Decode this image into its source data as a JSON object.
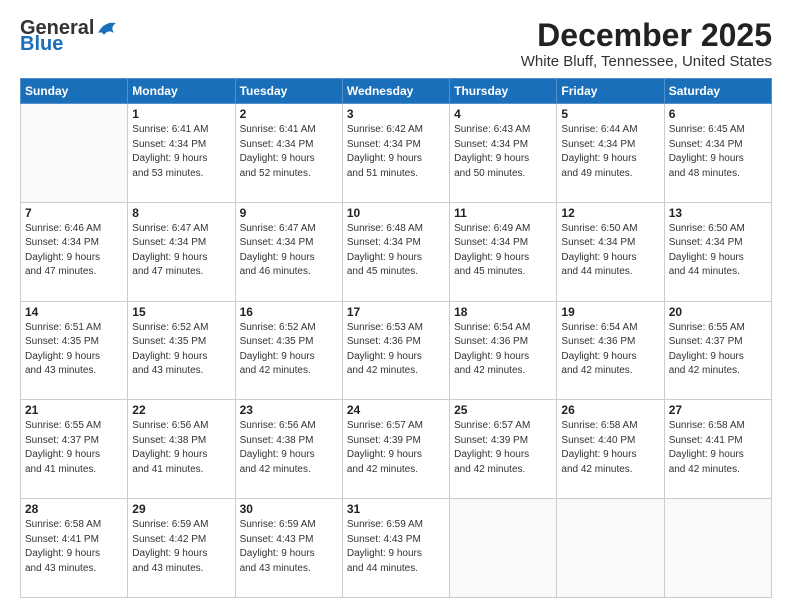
{
  "header": {
    "logo_general": "General",
    "logo_blue": "Blue",
    "month": "December 2025",
    "location": "White Bluff, Tennessee, United States"
  },
  "days_of_week": [
    "Sunday",
    "Monday",
    "Tuesday",
    "Wednesday",
    "Thursday",
    "Friday",
    "Saturday"
  ],
  "weeks": [
    [
      {
        "day": "",
        "info": ""
      },
      {
        "day": "1",
        "info": "Sunrise: 6:41 AM\nSunset: 4:34 PM\nDaylight: 9 hours\nand 53 minutes."
      },
      {
        "day": "2",
        "info": "Sunrise: 6:41 AM\nSunset: 4:34 PM\nDaylight: 9 hours\nand 52 minutes."
      },
      {
        "day": "3",
        "info": "Sunrise: 6:42 AM\nSunset: 4:34 PM\nDaylight: 9 hours\nand 51 minutes."
      },
      {
        "day": "4",
        "info": "Sunrise: 6:43 AM\nSunset: 4:34 PM\nDaylight: 9 hours\nand 50 minutes."
      },
      {
        "day": "5",
        "info": "Sunrise: 6:44 AM\nSunset: 4:34 PM\nDaylight: 9 hours\nand 49 minutes."
      },
      {
        "day": "6",
        "info": "Sunrise: 6:45 AM\nSunset: 4:34 PM\nDaylight: 9 hours\nand 48 minutes."
      }
    ],
    [
      {
        "day": "7",
        "info": "Sunrise: 6:46 AM\nSunset: 4:34 PM\nDaylight: 9 hours\nand 47 minutes."
      },
      {
        "day": "8",
        "info": "Sunrise: 6:47 AM\nSunset: 4:34 PM\nDaylight: 9 hours\nand 47 minutes."
      },
      {
        "day": "9",
        "info": "Sunrise: 6:47 AM\nSunset: 4:34 PM\nDaylight: 9 hours\nand 46 minutes."
      },
      {
        "day": "10",
        "info": "Sunrise: 6:48 AM\nSunset: 4:34 PM\nDaylight: 9 hours\nand 45 minutes."
      },
      {
        "day": "11",
        "info": "Sunrise: 6:49 AM\nSunset: 4:34 PM\nDaylight: 9 hours\nand 45 minutes."
      },
      {
        "day": "12",
        "info": "Sunrise: 6:50 AM\nSunset: 4:34 PM\nDaylight: 9 hours\nand 44 minutes."
      },
      {
        "day": "13",
        "info": "Sunrise: 6:50 AM\nSunset: 4:34 PM\nDaylight: 9 hours\nand 44 minutes."
      }
    ],
    [
      {
        "day": "14",
        "info": "Sunrise: 6:51 AM\nSunset: 4:35 PM\nDaylight: 9 hours\nand 43 minutes."
      },
      {
        "day": "15",
        "info": "Sunrise: 6:52 AM\nSunset: 4:35 PM\nDaylight: 9 hours\nand 43 minutes."
      },
      {
        "day": "16",
        "info": "Sunrise: 6:52 AM\nSunset: 4:35 PM\nDaylight: 9 hours\nand 42 minutes."
      },
      {
        "day": "17",
        "info": "Sunrise: 6:53 AM\nSunset: 4:36 PM\nDaylight: 9 hours\nand 42 minutes."
      },
      {
        "day": "18",
        "info": "Sunrise: 6:54 AM\nSunset: 4:36 PM\nDaylight: 9 hours\nand 42 minutes."
      },
      {
        "day": "19",
        "info": "Sunrise: 6:54 AM\nSunset: 4:36 PM\nDaylight: 9 hours\nand 42 minutes."
      },
      {
        "day": "20",
        "info": "Sunrise: 6:55 AM\nSunset: 4:37 PM\nDaylight: 9 hours\nand 42 minutes."
      }
    ],
    [
      {
        "day": "21",
        "info": "Sunrise: 6:55 AM\nSunset: 4:37 PM\nDaylight: 9 hours\nand 41 minutes."
      },
      {
        "day": "22",
        "info": "Sunrise: 6:56 AM\nSunset: 4:38 PM\nDaylight: 9 hours\nand 41 minutes."
      },
      {
        "day": "23",
        "info": "Sunrise: 6:56 AM\nSunset: 4:38 PM\nDaylight: 9 hours\nand 42 minutes."
      },
      {
        "day": "24",
        "info": "Sunrise: 6:57 AM\nSunset: 4:39 PM\nDaylight: 9 hours\nand 42 minutes."
      },
      {
        "day": "25",
        "info": "Sunrise: 6:57 AM\nSunset: 4:39 PM\nDaylight: 9 hours\nand 42 minutes."
      },
      {
        "day": "26",
        "info": "Sunrise: 6:58 AM\nSunset: 4:40 PM\nDaylight: 9 hours\nand 42 minutes."
      },
      {
        "day": "27",
        "info": "Sunrise: 6:58 AM\nSunset: 4:41 PM\nDaylight: 9 hours\nand 42 minutes."
      }
    ],
    [
      {
        "day": "28",
        "info": "Sunrise: 6:58 AM\nSunset: 4:41 PM\nDaylight: 9 hours\nand 43 minutes."
      },
      {
        "day": "29",
        "info": "Sunrise: 6:59 AM\nSunset: 4:42 PM\nDaylight: 9 hours\nand 43 minutes."
      },
      {
        "day": "30",
        "info": "Sunrise: 6:59 AM\nSunset: 4:43 PM\nDaylight: 9 hours\nand 43 minutes."
      },
      {
        "day": "31",
        "info": "Sunrise: 6:59 AM\nSunset: 4:43 PM\nDaylight: 9 hours\nand 44 minutes."
      },
      {
        "day": "",
        "info": ""
      },
      {
        "day": "",
        "info": ""
      },
      {
        "day": "",
        "info": ""
      }
    ]
  ]
}
